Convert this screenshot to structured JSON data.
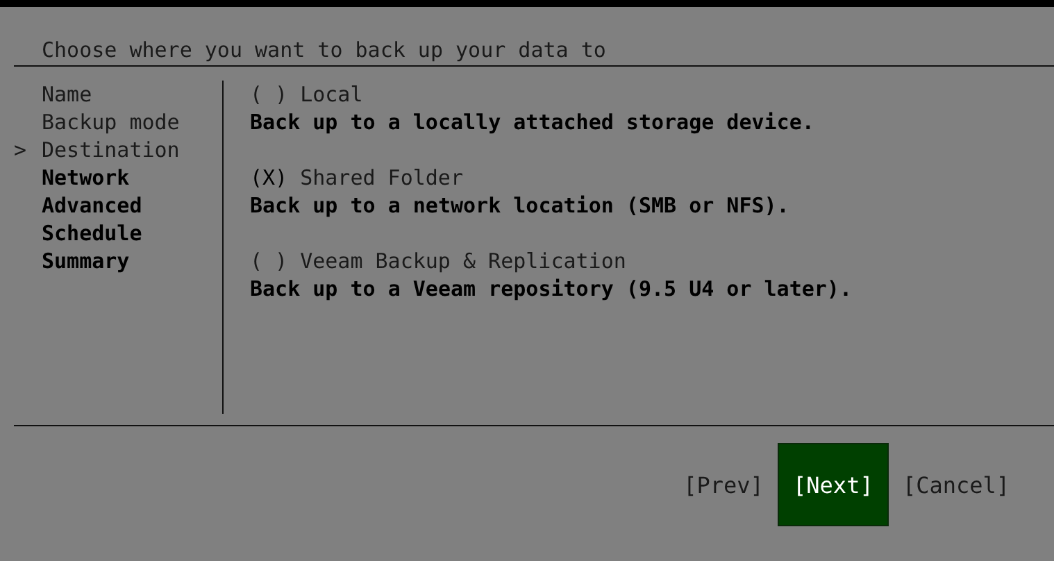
{
  "title": "Choose where you want to back up your data to",
  "steps": [
    {
      "label": "Name",
      "selected": false,
      "pending": false
    },
    {
      "label": "Backup mode",
      "selected": false,
      "pending": false
    },
    {
      "label": "Destination",
      "selected": true,
      "pending": false
    },
    {
      "label": "Network",
      "selected": false,
      "pending": true
    },
    {
      "label": "Advanced",
      "selected": false,
      "pending": true
    },
    {
      "label": "Schedule",
      "selected": false,
      "pending": true
    },
    {
      "label": "Summary",
      "selected": false,
      "pending": true
    }
  ],
  "current_step_marker": ">",
  "options": [
    {
      "radio": "( )",
      "label": "Local",
      "selected": false,
      "description": "Back up to a locally attached storage device."
    },
    {
      "radio": "(X)",
      "label": "Shared Folder",
      "selected": true,
      "description": "Back up to a network location (SMB or NFS)."
    },
    {
      "radio": "( )",
      "label": "Veeam Backup & Replication",
      "selected": false,
      "description": "Back up to a Veeam repository (9.5 U4 or later)."
    }
  ],
  "buttons": [
    {
      "label": "[Prev]",
      "selected": false
    },
    {
      "label": "[Next]",
      "selected": true
    },
    {
      "label": "[Cancel]",
      "selected": false
    }
  ]
}
